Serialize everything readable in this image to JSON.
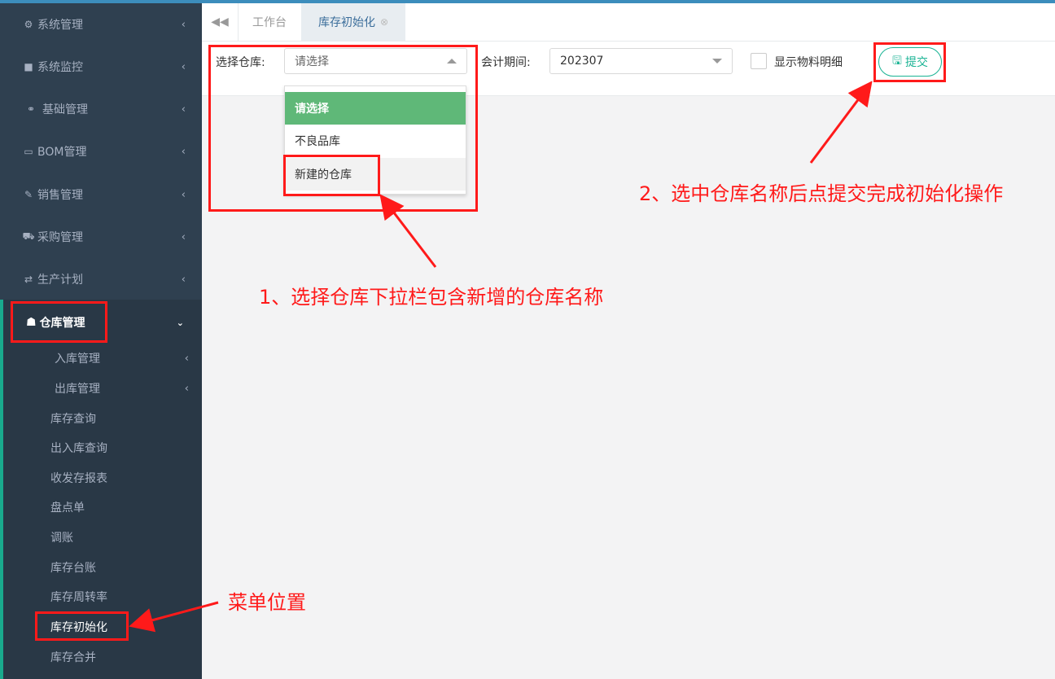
{
  "sidebar": {
    "items": [
      {
        "label": "系统管理",
        "icon": "gear-icon"
      },
      {
        "label": "系统监控",
        "icon": "video-camera-icon"
      },
      {
        "label": "基础管理",
        "icon": "bicycle-icon"
      },
      {
        "label": "BOM管理",
        "icon": "laptop-icon"
      },
      {
        "label": "销售管理",
        "icon": "edit-icon"
      },
      {
        "label": "采购管理",
        "icon": "cart-icon"
      },
      {
        "label": "生产计划",
        "icon": "exchange-icon"
      }
    ],
    "warehouse": {
      "label": "仓库管理",
      "icon": "cubes-icon"
    },
    "sub_items": [
      "入库管理",
      "出库管理",
      "库存查询",
      "出入库查询",
      "收发存报表",
      "盘点单",
      "调账",
      "库存台账",
      "库存周转率",
      "库存初始化",
      "库存合并"
    ]
  },
  "tabs": {
    "items": [
      "工作台",
      "库存初始化"
    ]
  },
  "toolbar": {
    "warehouse_label": "选择仓库:",
    "warehouse_placeholder": "请选择",
    "period_label": "会计期间:",
    "period_value": "202307",
    "show_detail_label": "显示物料明细",
    "submit_label": "提交"
  },
  "dropdown": {
    "options": [
      "请选择",
      "不良品库",
      "新建的仓库"
    ]
  },
  "annotations": {
    "step1": "1、选择仓库下拉栏包含新增的仓库名称",
    "step2": "2、选中仓库名称后点提交完成初始化操作",
    "menu_location": "菜单位置"
  },
  "colors": {
    "sidebar_bg": "#2f4050",
    "accent": "#1ab394",
    "selected_option": "#5fb878",
    "annotation_red": "#ff1a1a"
  }
}
